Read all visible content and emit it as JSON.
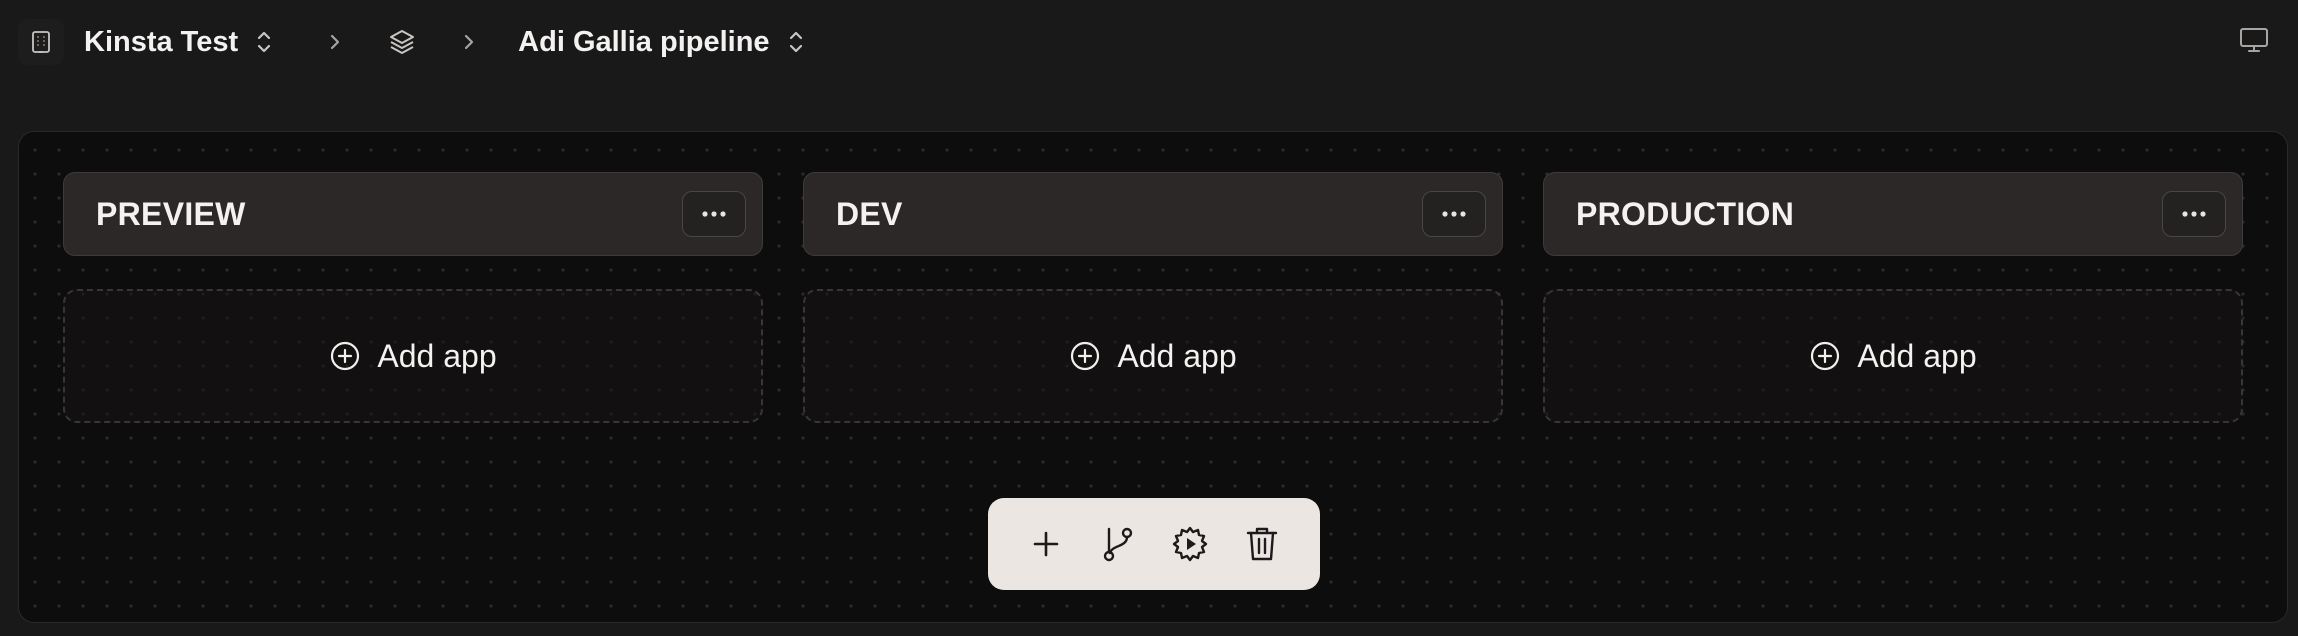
{
  "breadcrumb": {
    "org_name": "Kinsta Test",
    "pipeline_name": "Adi Gallia pipeline"
  },
  "stages": [
    {
      "title": "PREVIEW",
      "add_label": "Add app"
    },
    {
      "title": "DEV",
      "add_label": "Add app"
    },
    {
      "title": "PRODUCTION",
      "add_label": "Add app"
    }
  ],
  "toolbar": {
    "icons": [
      "plus-icon",
      "branch-icon",
      "gear-play-icon",
      "trash-icon"
    ]
  },
  "icons": {
    "org": "building-icon",
    "org_switch": "chevron-up-down-icon",
    "separator": "chevron-right-icon",
    "pipelines": "layers-icon",
    "pipeline_switch": "chevron-up-down-icon",
    "stage_menu": "more-horizontal-icon",
    "add": "plus-circle-icon",
    "view": "monitor-icon"
  },
  "colors": {
    "background": "#19191a",
    "canvas": "#0e0d0d",
    "stage_header": "#2c2828",
    "toolbar": "#ebe6e2",
    "text": "#f4f2f0"
  }
}
